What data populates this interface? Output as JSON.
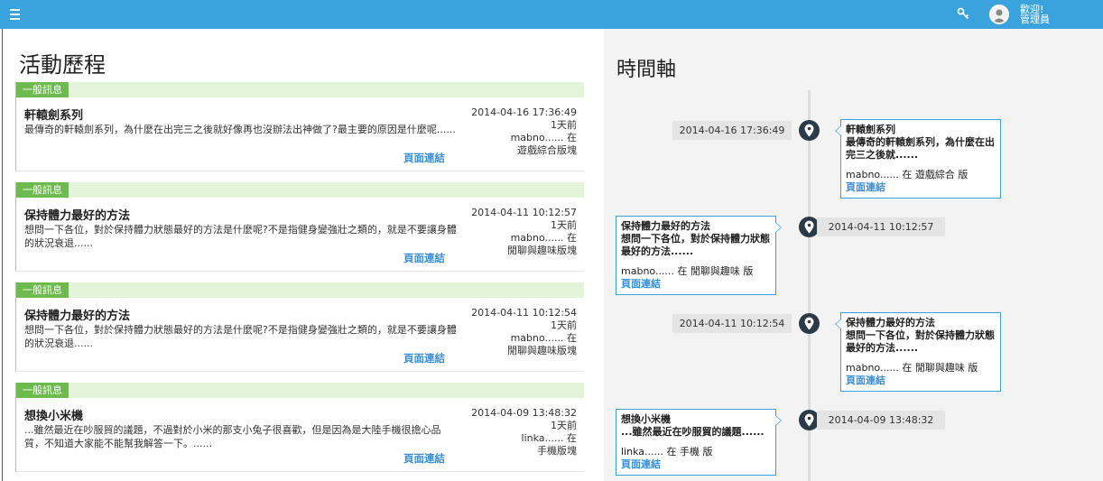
{
  "header": {
    "welcome_line1": "歡迎!",
    "welcome_line2": "管理員"
  },
  "activity": {
    "title": "活動歷程",
    "items": [
      {
        "badge": "一般訊息",
        "title": "軒轅劍系列",
        "body": "最傳奇的軒轅劍系列，為什麼在出完三之後就好像再也沒辦法出神做了?最主要的原因是什麼呢......",
        "date": "2014-04-16 17:36:49",
        "ago": "1天前",
        "author": "mabno...... 在",
        "board": "遊戲綜合版塊",
        "link": "頁面連結"
      },
      {
        "badge": "一般訊息",
        "title": "保持體力最好的方法",
        "body": "想問一下各位，對於保持體力狀態最好的方法是什麼呢?不是指健身變強壯之類的，就是不要讓身體的狀況衰退......",
        "date": "2014-04-11 10:12:57",
        "ago": "1天前",
        "author": "mabno...... 在",
        "board": "閒聊與趣味版塊",
        "link": "頁面連結"
      },
      {
        "badge": "一般訊息",
        "title": "保持體力最好的方法",
        "body": "想問一下各位，對於保持體力狀態最好的方法是什麼呢?不是指健身變強壯之類的，就是不要讓身體的狀況衰退......",
        "date": "2014-04-11 10:12:54",
        "ago": "1天前",
        "author": "mabno...... 在",
        "board": "閒聊與趣味版塊",
        "link": "頁面連結"
      },
      {
        "badge": "一般訊息",
        "title": "想換小米機",
        "body": "...雖然最近在吵服貿的議題，不過對於小米的那支小兔子很喜歡，但是因為是大陸手機很擔心品質，不知道大家能不能幫我解答一下。......",
        "date": "2014-04-09 13:48:32",
        "ago": "1天前",
        "author": "linka...... 在",
        "board": "手機版塊",
        "link": "頁面連結"
      }
    ]
  },
  "timeline": {
    "title": "時間軸",
    "items": [
      {
        "date": "2014-04-16 17:36:49",
        "title": "軒轅劍系列",
        "desc": "最傳奇的軒轅劍系列，為什麼在出完三之後就......",
        "meta": "mabno...... 在 遊戲綜合 版",
        "link": "頁面連結"
      },
      {
        "date": "2014-04-11 10:12:57",
        "title": "保持體力最好的方法",
        "desc": "想問一下各位，對於保持體力狀態最好的方法......",
        "meta": "mabno...... 在 閒聊與趣味 版",
        "link": "頁面連結"
      },
      {
        "date": "2014-04-11 10:12:54",
        "title": "保持體力最好的方法",
        "desc": "想問一下各位，對於保持體力狀態最好的方法......",
        "meta": "mabno...... 在 閒聊與趣味 版",
        "link": "頁面連結"
      },
      {
        "date": "2014-04-09 13:48:32",
        "title": "想換小米機",
        "desc": "...雖然最近在吵服貿的議題......",
        "meta": "linka...... 在 手機 版",
        "link": "頁面連結"
      }
    ]
  },
  "colors": {
    "topbar": "#3aa3dd",
    "badge": "#6dbb4e",
    "link": "#3a8fd6",
    "pin": "#2b3a48"
  }
}
